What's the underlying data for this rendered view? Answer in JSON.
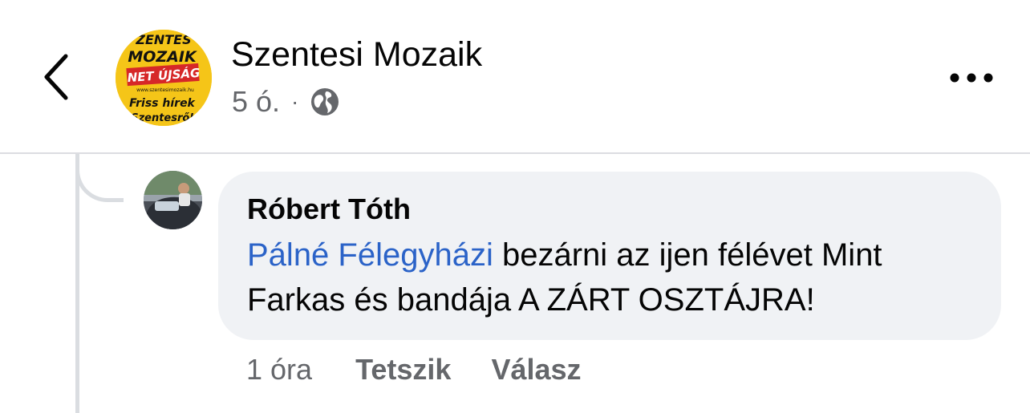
{
  "header": {
    "page_name": "Szentesi Mozaik",
    "time": "5 ó.",
    "separator": "·",
    "privacy_icon": "globe-icon",
    "back_icon": "chevron-left-icon",
    "more_icon": "more-horizontal-icon"
  },
  "logo": {
    "line1": "ZENTES",
    "line2": "MOZAIK",
    "line3": "NET ÚJSÁG",
    "url": "www.szentesimozaik.hu",
    "line4": "Friss hírek",
    "line5": "Szentesről"
  },
  "comment": {
    "author": "Róbert Tóth",
    "mention": "Pálné Félegyházi",
    "text": " bezárni az ijen félévet Mint Farkas és bandája A ZÁRT OSZTÁJRA!",
    "time": "1 óra",
    "like_label": "Tetszik",
    "reply_label": "Válasz"
  },
  "colors": {
    "mention": "#2b63c8",
    "bubble": "#f0f2f5",
    "secondary_text": "#65676b",
    "logo_yellow": "#f5c518",
    "logo_red": "#d62828"
  }
}
